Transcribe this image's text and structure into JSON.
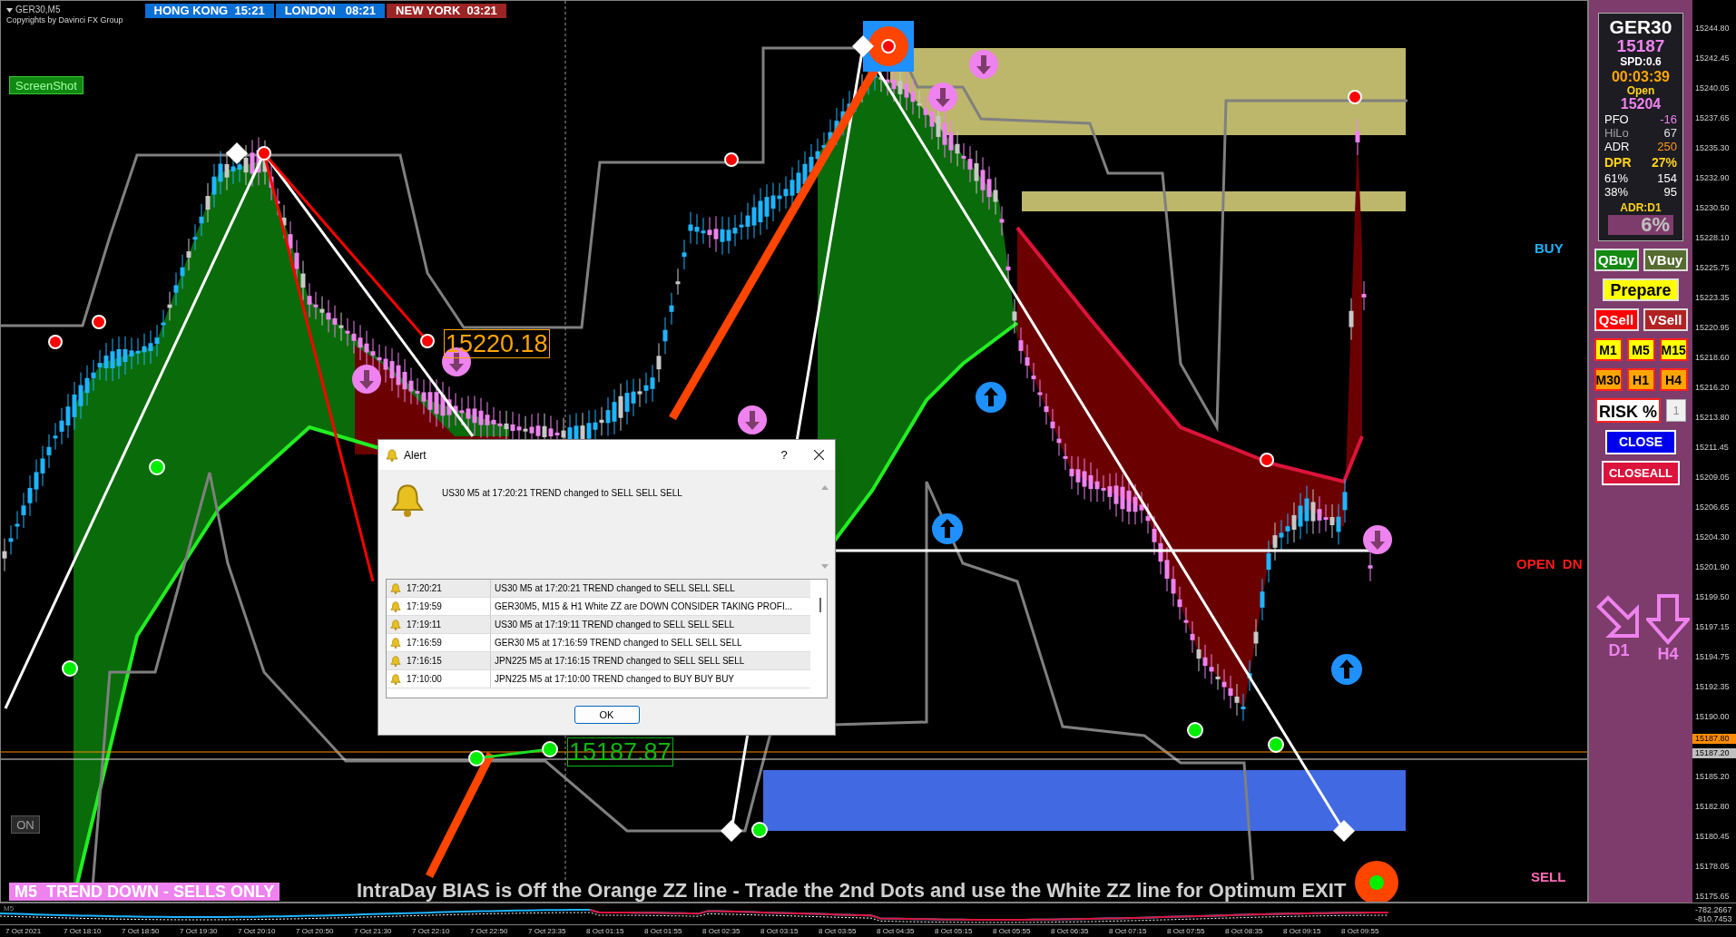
{
  "chart": {
    "symbol": "GER30,M5",
    "copyright": "Copyrights by Davinci FX Group",
    "sessions": [
      {
        "label": "HONG KONG  15:21",
        "color": "#0b6fd6"
      },
      {
        "label": "LONDON   08:21",
        "color": "#0b6fd6"
      },
      {
        "label": "NEW YORK  03:21",
        "color": "#9b2424"
      }
    ],
    "screenshot_button": "ScreenShot",
    "price_labels": [
      {
        "text": "15220.18",
        "kind": "high"
      },
      {
        "text": "15187.87",
        "kind": "low"
      }
    ],
    "signals": [
      {
        "text": "BUY",
        "kind": "buy"
      },
      {
        "text": "OPEN  DN",
        "kind": "open"
      },
      {
        "text": "SELL",
        "kind": "sell"
      }
    ],
    "on_button": "ON",
    "trend_banner": "M5  TREND DOWN - SELLS ONLY",
    "bias_text": "IntraDay BIAS is Off the Orange ZZ line - Trade the 2nd Dots and use the White ZZ line for Optimum EXIT"
  },
  "panel": {
    "symbol": "GER30",
    "price": "15187",
    "spread": "SPD:0.6",
    "timer": "00:03:39",
    "open_label": "Open",
    "open_price": "15204",
    "stats": [
      {
        "label": "PFO",
        "value": "-16",
        "kind": "pfo"
      },
      {
        "label": "HiLo",
        "value": "67",
        "kind": "hilo"
      },
      {
        "label": "ADR",
        "value": "250",
        "kind": "adr"
      },
      {
        "label": "DPR",
        "value": "27%",
        "kind": "dpr"
      },
      {
        "label": "61%",
        "value": "154",
        "kind": "fib"
      },
      {
        "label": "38%",
        "value": "95",
        "kind": "fib"
      }
    ],
    "adr_timeframe": "ADR:D1",
    "dpr_box": "6%",
    "button_rows": [
      [
        {
          "label": "QBuy",
          "kind": "qbuy"
        },
        {
          "label": "VBuy",
          "kind": "vbuy"
        }
      ],
      [
        {
          "label": "Prepare",
          "kind": "prepare"
        }
      ],
      [
        {
          "label": "QSell",
          "kind": "qsell"
        },
        {
          "label": "VSell",
          "kind": "vsell"
        }
      ],
      [
        {
          "label": "M1",
          "kind": "minute"
        },
        {
          "label": "M5",
          "kind": "minute"
        },
        {
          "label": "M15",
          "kind": "minute"
        }
      ],
      [
        {
          "label": "M30",
          "kind": "hour"
        },
        {
          "label": "H1",
          "kind": "hour"
        },
        {
          "label": "H4",
          "kind": "hour"
        }
      ]
    ],
    "risk_label": "RISK %",
    "risk_value": "1",
    "close_button": "CLOSE",
    "closeall_button": "CLOSEALL",
    "arrows": [
      {
        "label": "D1",
        "kind": "down-right"
      },
      {
        "label": "H4",
        "kind": "down"
      }
    ]
  },
  "price_axis": [
    {
      "text": "15244.80",
      "kind": "tick"
    },
    {
      "text": "15242.45",
      "kind": "tick"
    },
    {
      "text": "15240.05",
      "kind": "tick"
    },
    {
      "text": "15237.65",
      "kind": "tick"
    },
    {
      "text": "15235.30",
      "kind": "tick"
    },
    {
      "text": "15232.90",
      "kind": "tick"
    },
    {
      "text": "15230.50",
      "kind": "tick"
    },
    {
      "text": "15228.10",
      "kind": "tick"
    },
    {
      "text": "15225.75",
      "kind": "tick"
    },
    {
      "text": "15223.35",
      "kind": "tick"
    },
    {
      "text": "15220.95",
      "kind": "tick"
    },
    {
      "text": "15218.60",
      "kind": "tick"
    },
    {
      "text": "15216.20",
      "kind": "tick"
    },
    {
      "text": "15213.80",
      "kind": "tick"
    },
    {
      "text": "15211.45",
      "kind": "tick"
    },
    {
      "text": "15209.05",
      "kind": "tick"
    },
    {
      "text": "15206.65",
      "kind": "tick"
    },
    {
      "text": "15204.30",
      "kind": "tick"
    },
    {
      "text": "15201.90",
      "kind": "tick"
    },
    {
      "text": "15199.50",
      "kind": "tick"
    },
    {
      "text": "15197.15",
      "kind": "tick"
    },
    {
      "text": "15194.75",
      "kind": "tick"
    },
    {
      "text": "15192.35",
      "kind": "tick"
    },
    {
      "text": "15190.00",
      "kind": "tick"
    },
    {
      "text": "15187.80",
      "kind": "marker",
      "color": "#ff8c00"
    },
    {
      "text": "15187.20",
      "kind": "marker",
      "color": "#c0c0c0"
    },
    {
      "text": "15185.20",
      "kind": "tick"
    },
    {
      "text": "15182.80",
      "kind": "tick"
    },
    {
      "text": "15180.45",
      "kind": "tick"
    },
    {
      "text": "15178.05",
      "kind": "tick"
    },
    {
      "text": "15175.65",
      "kind": "tick"
    }
  ],
  "indicator": {
    "label": "M5",
    "axis": [
      "-782.2667",
      "-810.7453"
    ]
  },
  "time_axis": [
    "7 Oct 2021",
    "7 Oct 18:10",
    "7 Oct 18:50",
    "7 Oct 19:30",
    "7 Oct 20:10",
    "7 Oct 20:50",
    "7 Oct 21:30",
    "7 Oct 22:10",
    "7 Oct 22:50",
    "7 Oct 23:35",
    "8 Oct 01:15",
    "8 Oct 01:55",
    "8 Oct 02:35",
    "8 Oct 03:15",
    "8 Oct 03:55",
    "8 Oct 04:35",
    "8 Oct 05:15",
    "8 Oct 05:55",
    "8 Oct 06:35",
    "8 Oct 07:15",
    "8 Oct 07:55",
    "8 Oct 08:35",
    "8 Oct 09:15",
    "8 Oct 09:55"
  ],
  "alert": {
    "title": "Alert",
    "help": "?",
    "message": "US30 M5 at 17:20:21 TREND changed to SELL SELL SELL",
    "rows": [
      {
        "time": "17:20:21",
        "text": "US30 M5 at 17:20:21 TREND changed to SELL SELL SELL"
      },
      {
        "time": "17:19:59",
        "text": "GER30M5, M15 & H1 White ZZ are DOWN CONSIDER TAKING PROFI..."
      },
      {
        "time": "17:19:11",
        "text": "US30 M5 at 17:19:11 TREND changed to SELL SELL SELL"
      },
      {
        "time": "17:16:59",
        "text": "GER30 M5 at 17:16:59 TREND changed to SELL SELL SELL"
      },
      {
        "time": "17:16:15",
        "text": "JPN225 M5 at 17:16:15 TREND changed to SELL SELL SELL"
      },
      {
        "time": "17:10:00",
        "text": "JPN225 M5 at 17:10:00 TREND changed to BUY BUY BUY"
      }
    ],
    "ok": "OK"
  }
}
